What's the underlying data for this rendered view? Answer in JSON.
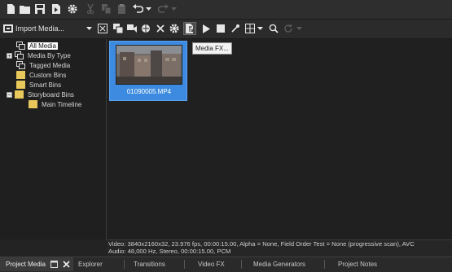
{
  "media_toolbar": {
    "import_label": "Import Media..."
  },
  "tooltip": {
    "text": "Media FX..."
  },
  "tree": {
    "items": [
      {
        "label": "All Media",
        "selected": true
      },
      {
        "label": "Media By Type"
      },
      {
        "label": "Tagged Media"
      },
      {
        "label": "Custom Bins"
      },
      {
        "label": "Smart Bins"
      },
      {
        "label": "Storyboard Bins"
      },
      {
        "label": "Main Timeline"
      }
    ]
  },
  "media": {
    "filename": "01090005.MP4"
  },
  "info": {
    "video": "Video: 3840x2160x32, 23.976 fps, 00:00:15.00, Alpha = None, Field Order Test = None (progressive scan), AVC",
    "audio": "Audio: 48,000 Hz, Stereo, 00:00:15.00, PCM"
  },
  "tabs": [
    "Project Media",
    "Explorer",
    "Transitions",
    "Video FX",
    "Media Generators",
    "Project Notes"
  ],
  "colors": {
    "accent": "#3d8be0",
    "tree_folder": "#e8c85a",
    "background": "#232323"
  }
}
